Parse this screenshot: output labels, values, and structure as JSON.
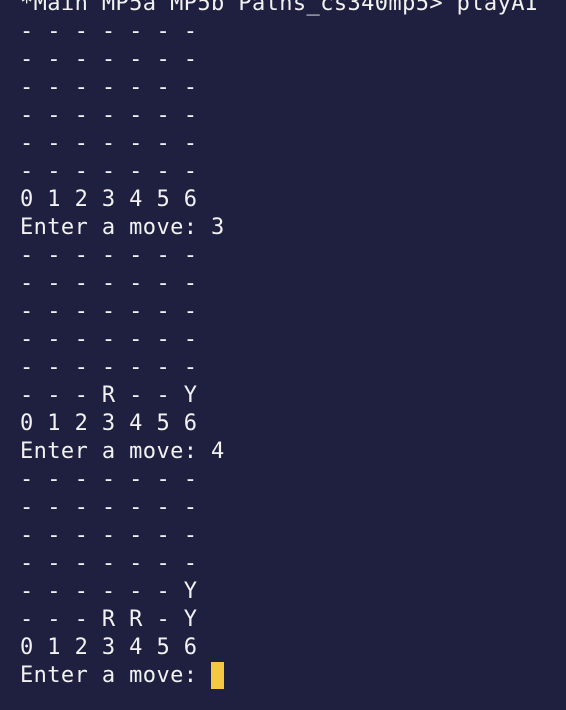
{
  "prompt": "*Main MP5a MP5b Paths_cs340mp5> playAI",
  "boards": [
    {
      "rows": [
        "- - - - - - -",
        "- - - - - - -",
        "- - - - - - -",
        "- - - - - - -",
        "- - - - - - -",
        "- - - - - - -"
      ],
      "column_labels": "0 1 2 3 4 5 6",
      "move_prompt": "Enter a move: 3"
    },
    {
      "rows": [
        "- - - - - - -",
        "- - - - - - -",
        "- - - - - - -",
        "- - - - - - -",
        "- - - - - - -",
        "- - - R - - Y"
      ],
      "column_labels": "0 1 2 3 4 5 6",
      "move_prompt": "Enter a move: 4"
    },
    {
      "rows": [
        "- - - - - - -",
        "- - - - - - -",
        "- - - - - - -",
        "- - - - - - -",
        "- - - - - - Y",
        "- - - R R - Y"
      ],
      "column_labels": "0 1 2 3 4 5 6",
      "move_prompt": "Enter a move: "
    }
  ],
  "colors": {
    "background": "#1f2040",
    "text": "#f2f2f2",
    "cursor": "#f5c842"
  }
}
